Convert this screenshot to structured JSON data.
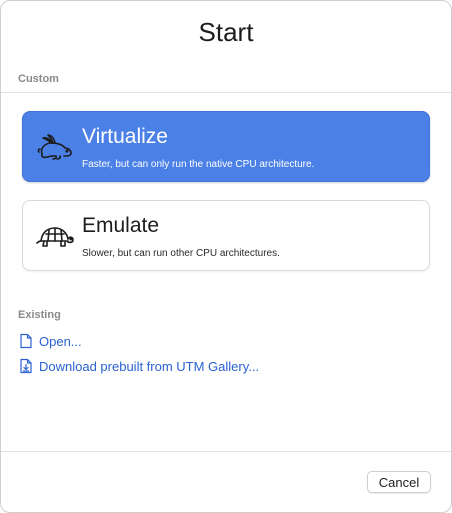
{
  "dialog": {
    "title": "Start"
  },
  "custom": {
    "section_label": "Custom",
    "options": [
      {
        "title": "Virtualize",
        "subtitle": "Faster, but can only run the native CPU architecture.",
        "icon": "hare-icon",
        "selected": true
      },
      {
        "title": "Emulate",
        "subtitle": "Slower, but can run other CPU architectures.",
        "icon": "tortoise-icon",
        "selected": false
      }
    ]
  },
  "existing": {
    "section_label": "Existing",
    "links": [
      {
        "label": "Open...",
        "icon": "document-icon"
      },
      {
        "label": "Download prebuilt from UTM Gallery...",
        "icon": "download-document-icon"
      }
    ]
  },
  "footer": {
    "cancel_label": "Cancel"
  },
  "colors": {
    "accent": "#4b80e6",
    "link": "#2a62d1",
    "section_label": "#8a8a8e"
  }
}
